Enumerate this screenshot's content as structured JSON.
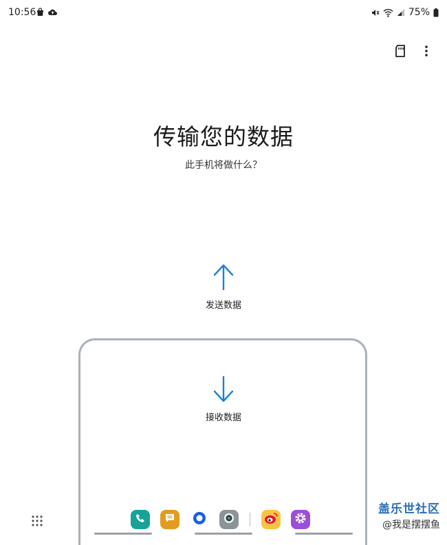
{
  "status_bar": {
    "time": "10:56",
    "battery": "75%",
    "left_icons": [
      "shopping-bag-icon",
      "cloud-upload-icon"
    ],
    "right_icons": [
      "mute-icon",
      "wifi-icon",
      "signal-icon",
      "battery-icon"
    ]
  },
  "header": {
    "actions": [
      "sd-card-icon",
      "more-options-icon"
    ]
  },
  "main": {
    "title": "传输您的数据",
    "subtitle": "此手机将做什么？",
    "send_label": "发送数据",
    "receive_label": "接收数据"
  },
  "colors": {
    "accent": "#1a7fe0",
    "frame": "#a9b1b9"
  },
  "taskbar": {
    "apps": [
      "phone-app",
      "messages-app",
      "browser-app",
      "camera-app",
      "weibo-app",
      "settings-app"
    ]
  },
  "watermark": {
    "main": "盖乐世社区",
    "sub": "@我是摆摆鱼"
  }
}
